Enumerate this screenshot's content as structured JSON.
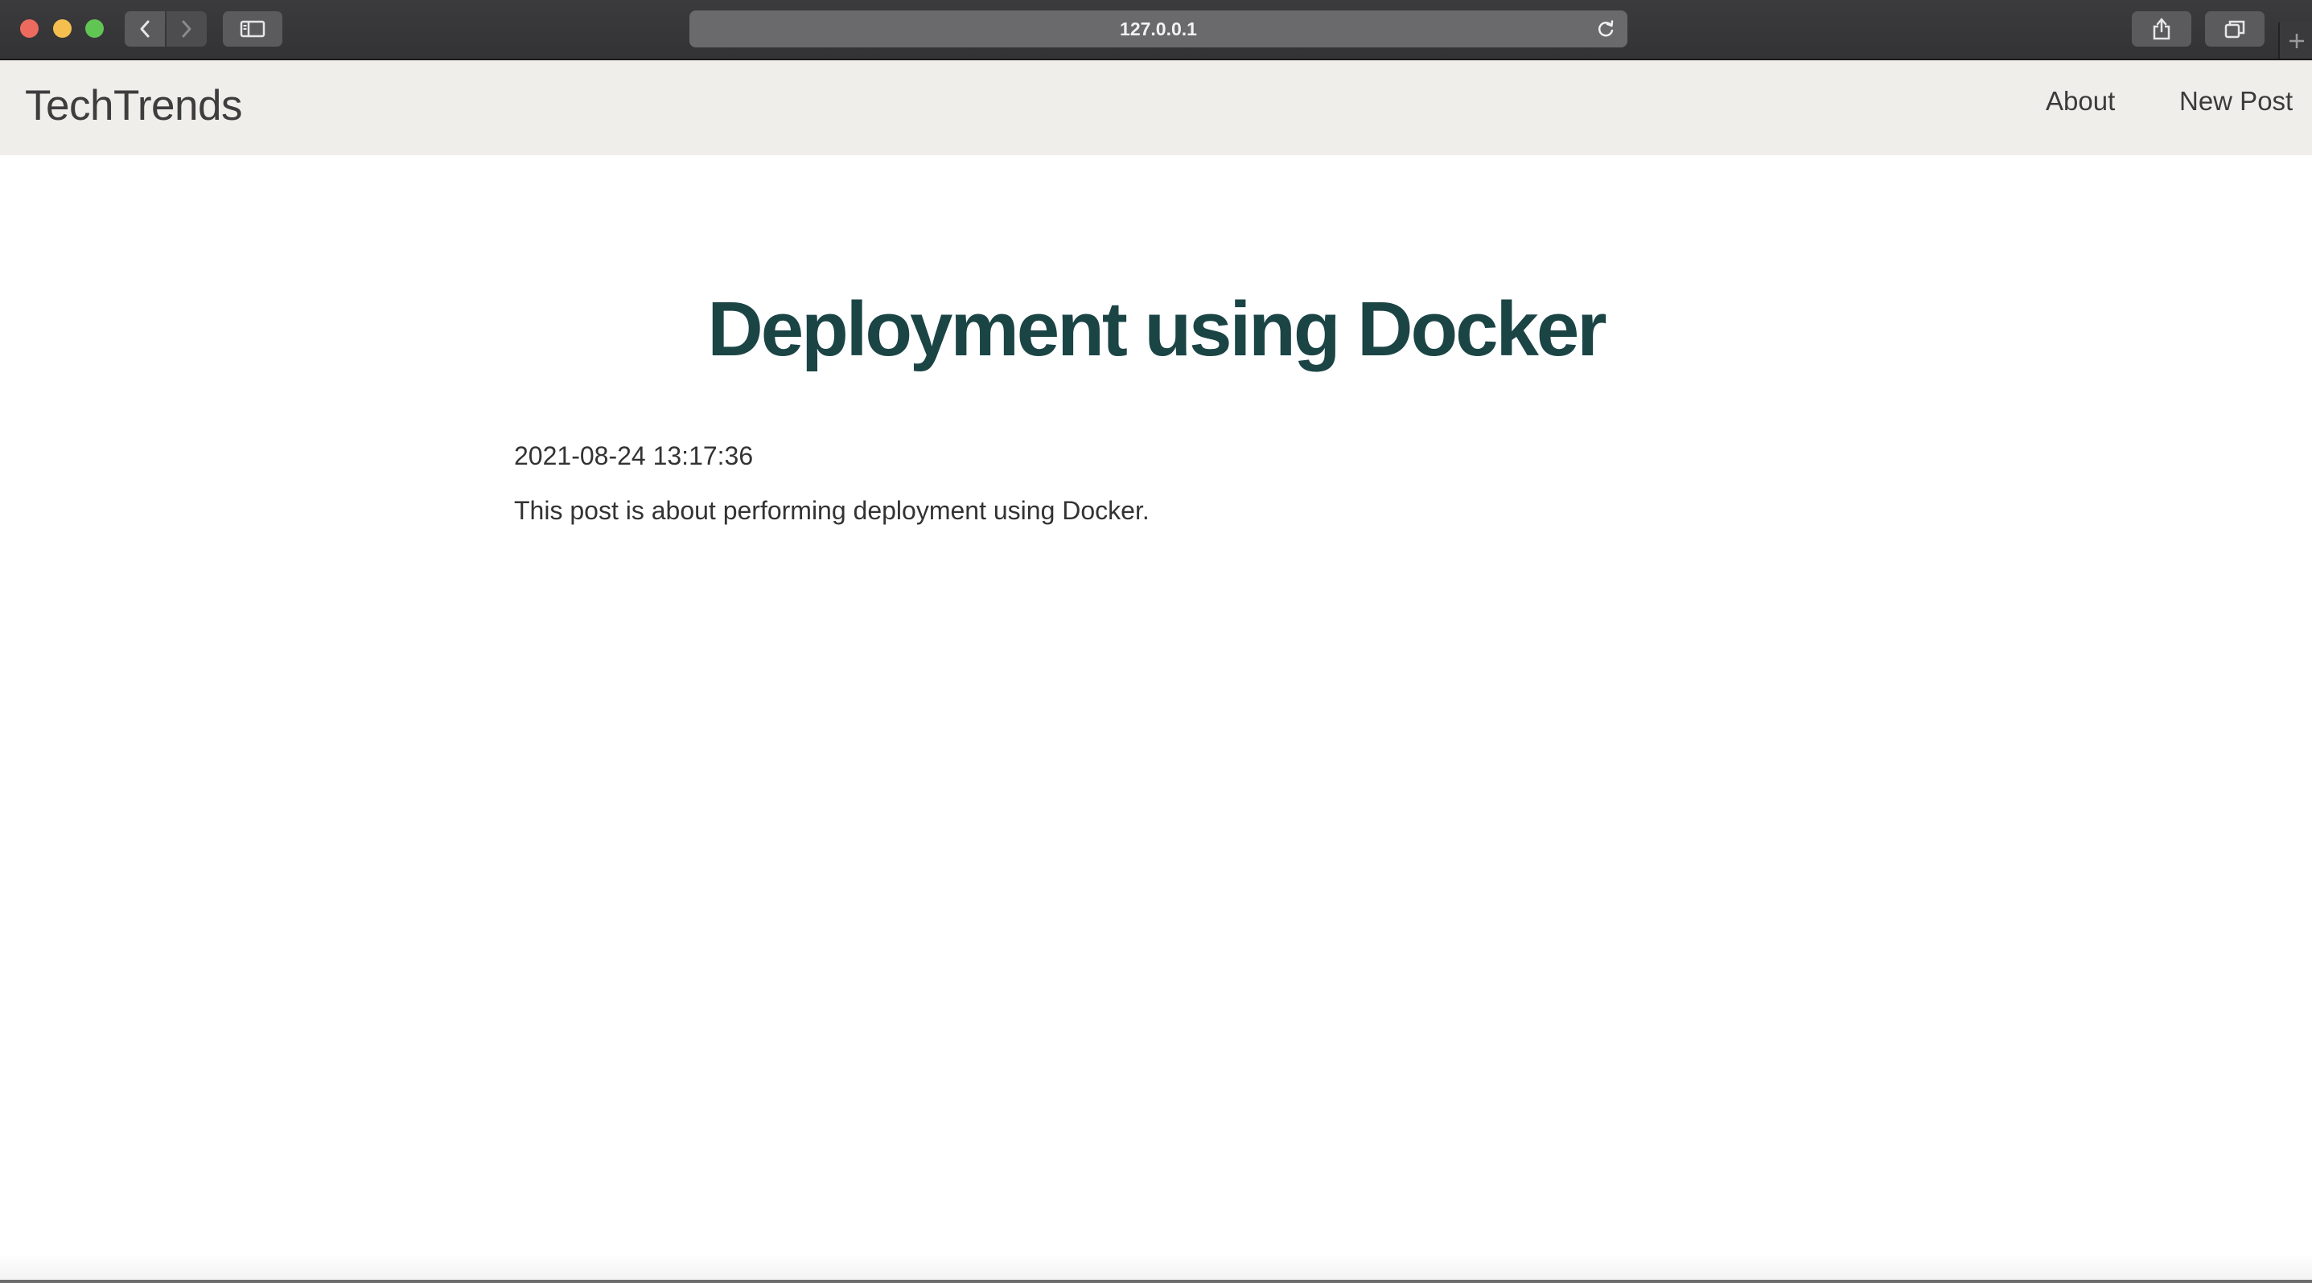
{
  "browser": {
    "url": "127.0.0.1",
    "icons": {
      "back": "chevron-left-icon",
      "forward": "chevron-right-icon",
      "sidebar": "sidebar-icon",
      "reload": "reload-icon",
      "share": "share-icon",
      "tabs": "tabs-overview-icon",
      "new_tab": "plus-icon"
    }
  },
  "navbar": {
    "brand": "TechTrends",
    "links": [
      {
        "label": "About"
      },
      {
        "label": "New Post"
      }
    ]
  },
  "post": {
    "title": "Deployment using Docker",
    "created": "2021-08-24 13:17:36",
    "content": "This post is about performing deployment using Docker."
  },
  "colors": {
    "title": "#1b4445",
    "navbar_bg": "#efeeeb"
  }
}
